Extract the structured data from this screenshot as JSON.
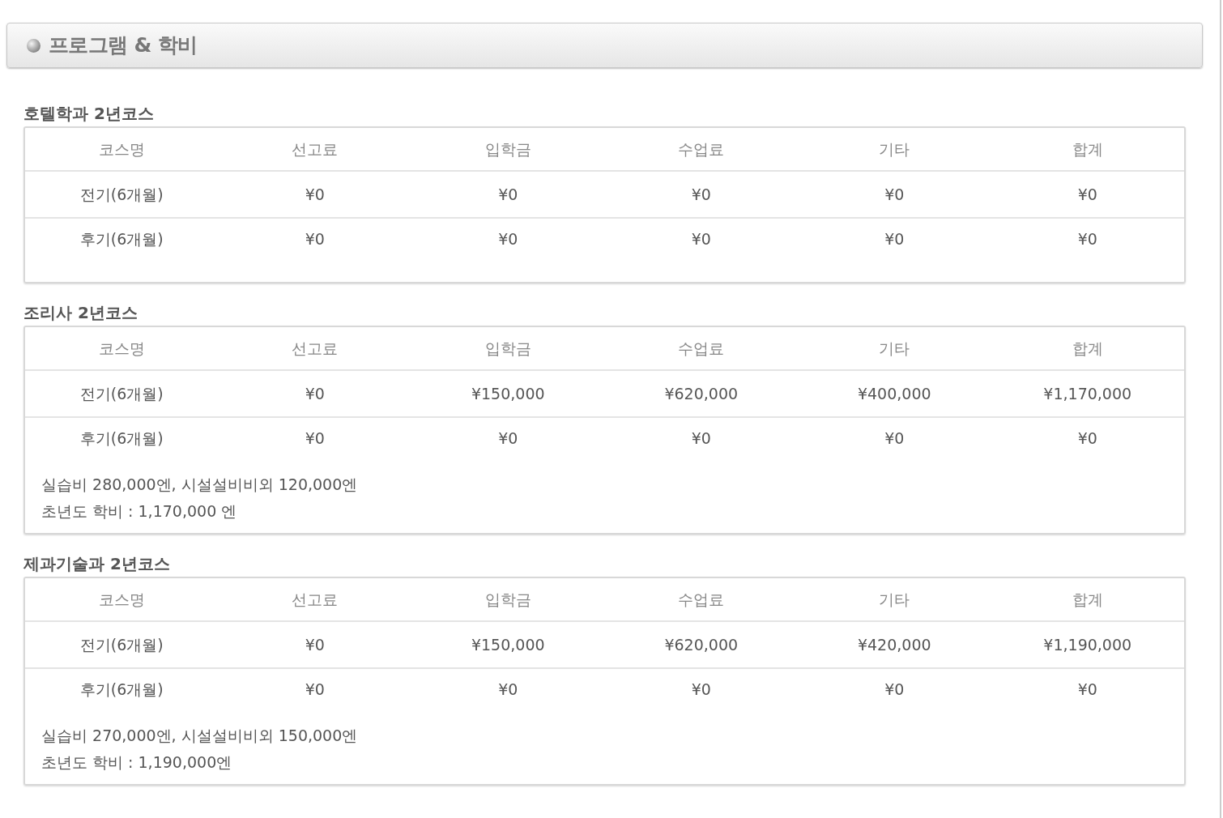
{
  "header": {
    "title": "프로그램 & 학비"
  },
  "sections": [
    {
      "title": "호텔학과 2년코스",
      "columns": [
        "코스명",
        "선고료",
        "입학금",
        "수업료",
        "기타",
        "합계"
      ],
      "rows": [
        [
          "전기(6개월)",
          "¥0",
          "¥0",
          "¥0",
          "¥0",
          "¥0"
        ],
        [
          "후기(6개월)",
          "¥0",
          "¥0",
          "¥0",
          "¥0",
          "¥0"
        ]
      ]
    },
    {
      "title": "조리사 2년코스",
      "columns": [
        "코스명",
        "선고료",
        "입학금",
        "수업료",
        "기타",
        "합계"
      ],
      "rows": [
        [
          "전기(6개월)",
          "¥0",
          "¥150,000",
          "¥620,000",
          "¥400,000",
          "¥1,170,000"
        ],
        [
          "후기(6개월)",
          "¥0",
          "¥0",
          "¥0",
          "¥0",
          "¥0"
        ]
      ],
      "notes": [
        "실습비 280,000엔, 시설설비비외 120,000엔",
        "초년도 학비 : 1,170,000 엔"
      ]
    },
    {
      "title": "제과기술과 2년코스",
      "columns": [
        "코스명",
        "선고료",
        "입학금",
        "수업료",
        "기타",
        "합계"
      ],
      "rows": [
        [
          "전기(6개월)",
          "¥0",
          "¥150,000",
          "¥620,000",
          "¥420,000",
          "¥1,190,000"
        ],
        [
          "후기(6개월)",
          "¥0",
          "¥0",
          "¥0",
          "¥0",
          "¥0"
        ]
      ],
      "notes": [
        "실습비 270,000엔, 시설설비비외 150,000엔",
        "초년도 학비 : 1,190,000엔"
      ]
    }
  ]
}
